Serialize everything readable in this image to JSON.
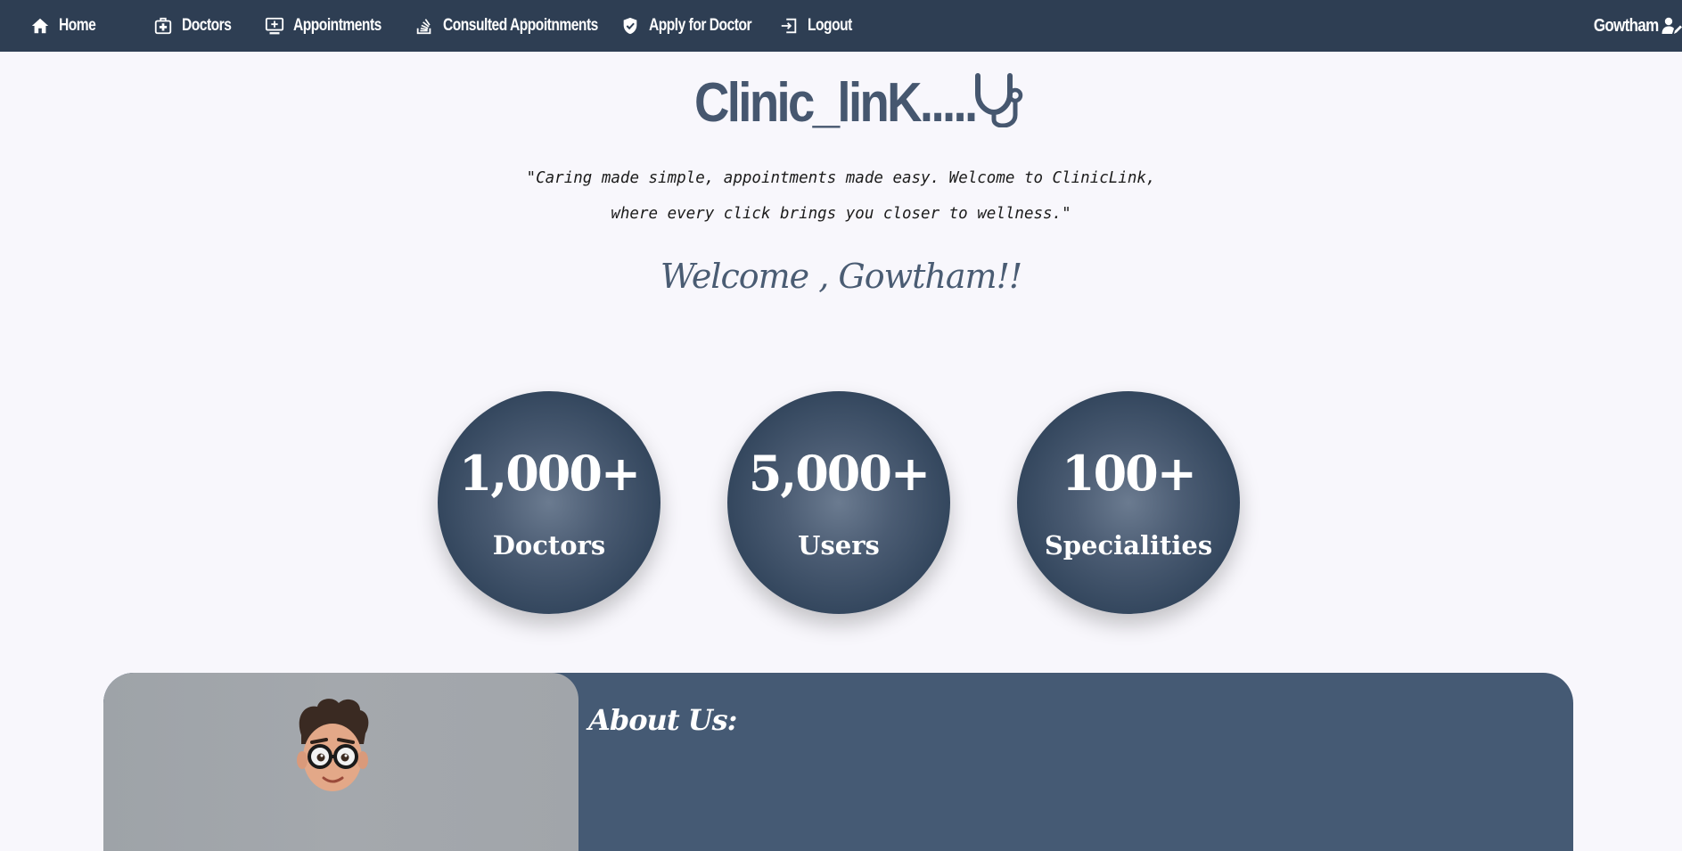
{
  "nav": {
    "items": [
      {
        "label": "Home",
        "icon": "home-icon"
      },
      {
        "label": "Doctors",
        "icon": "medical-bag-icon"
      },
      {
        "label": "Appointments",
        "icon": "monitor-plus-icon"
      },
      {
        "label": "Consulted Appoitnments",
        "icon": "stack-overflow-icon"
      },
      {
        "label": "Apply for Doctor",
        "icon": "shield-check-icon"
      },
      {
        "label": "Logout",
        "icon": "logout-icon"
      }
    ],
    "user": {
      "label": "Gowtham",
      "icon": "user-edit-icon"
    }
  },
  "hero": {
    "brand": "Clinic_linK.....",
    "brand_icon": "stethoscope-icon",
    "quote_line1": "\"Caring made simple, appointments made easy. Welcome to ClinicLink,",
    "quote_line2": "where every click brings you closer to wellness.\"",
    "welcome": "Welcome , Gowtham!!"
  },
  "stats": [
    {
      "value": "1,000+",
      "label": "Doctors"
    },
    {
      "value": "5,000+",
      "label": "Users"
    },
    {
      "value": "100+",
      "label": "Specialities"
    }
  ],
  "about": {
    "title": "About Us:",
    "image": "cartoon-doctor-avatar"
  },
  "colors": {
    "navbar": "#2e3e53",
    "page_bg": "#f8f7fc",
    "brand": "#46576f",
    "stat_bg": "#34475e",
    "about_bg": "#455a74"
  }
}
